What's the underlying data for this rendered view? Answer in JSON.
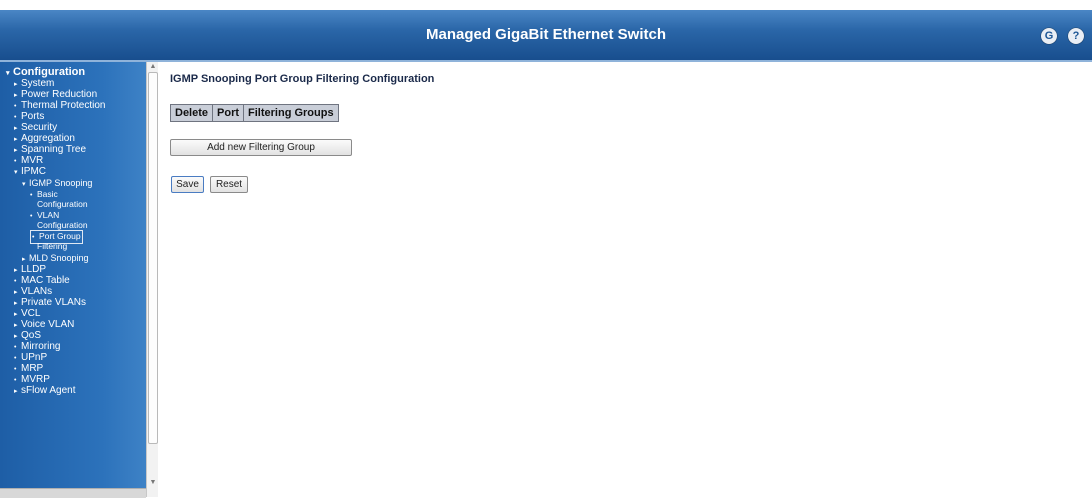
{
  "header": {
    "title": "Managed GigaBit Ethernet Switch",
    "logout_icon": "G",
    "help_icon": "?"
  },
  "sidebar": {
    "items": [
      {
        "label": "Configuration",
        "marker": "▾"
      },
      {
        "label": "System",
        "marker": "▸"
      },
      {
        "label": "Power Reduction",
        "marker": "▸"
      },
      {
        "label": "Thermal Protection",
        "marker": "•"
      },
      {
        "label": "Ports",
        "marker": "•"
      },
      {
        "label": "Security",
        "marker": "▸"
      },
      {
        "label": "Aggregation",
        "marker": "▸"
      },
      {
        "label": "Spanning Tree",
        "marker": "▸"
      },
      {
        "label": "MVR",
        "marker": "•"
      },
      {
        "label": "IPMC",
        "marker": "▾"
      },
      {
        "label": "IGMP Snooping",
        "marker": "▾"
      },
      {
        "label": "Basic",
        "marker": "•"
      },
      {
        "label": "Configuration",
        "marker": ""
      },
      {
        "label": "VLAN",
        "marker": "•"
      },
      {
        "label": "Configuration",
        "marker": ""
      },
      {
        "label": "Port Group",
        "marker": "•"
      },
      {
        "label": "Filtering",
        "marker": ""
      },
      {
        "label": "MLD Snooping",
        "marker": "▸"
      },
      {
        "label": "LLDP",
        "marker": "▸"
      },
      {
        "label": "MAC Table",
        "marker": "•"
      },
      {
        "label": "VLANs",
        "marker": "▸"
      },
      {
        "label": "Private VLANs",
        "marker": "▸"
      },
      {
        "label": "VCL",
        "marker": "▸"
      },
      {
        "label": "Voice VLAN",
        "marker": "▸"
      },
      {
        "label": "QoS",
        "marker": "▸"
      },
      {
        "label": "Mirroring",
        "marker": "•"
      },
      {
        "label": "UPnP",
        "marker": "•"
      },
      {
        "label": "MRP",
        "marker": "•"
      },
      {
        "label": "MVRP",
        "marker": "•"
      },
      {
        "label": "sFlow Agent",
        "marker": "▸"
      }
    ]
  },
  "main": {
    "title": "IGMP Snooping Port Group Filtering Configuration",
    "columns": [
      "Delete",
      "Port",
      "Filtering Groups"
    ],
    "add_button": "Add new Filtering Group",
    "save_button": "Save",
    "reset_button": "Reset"
  },
  "colors": {
    "header": "#2a66a8",
    "sidebar": "#2c72bb"
  }
}
